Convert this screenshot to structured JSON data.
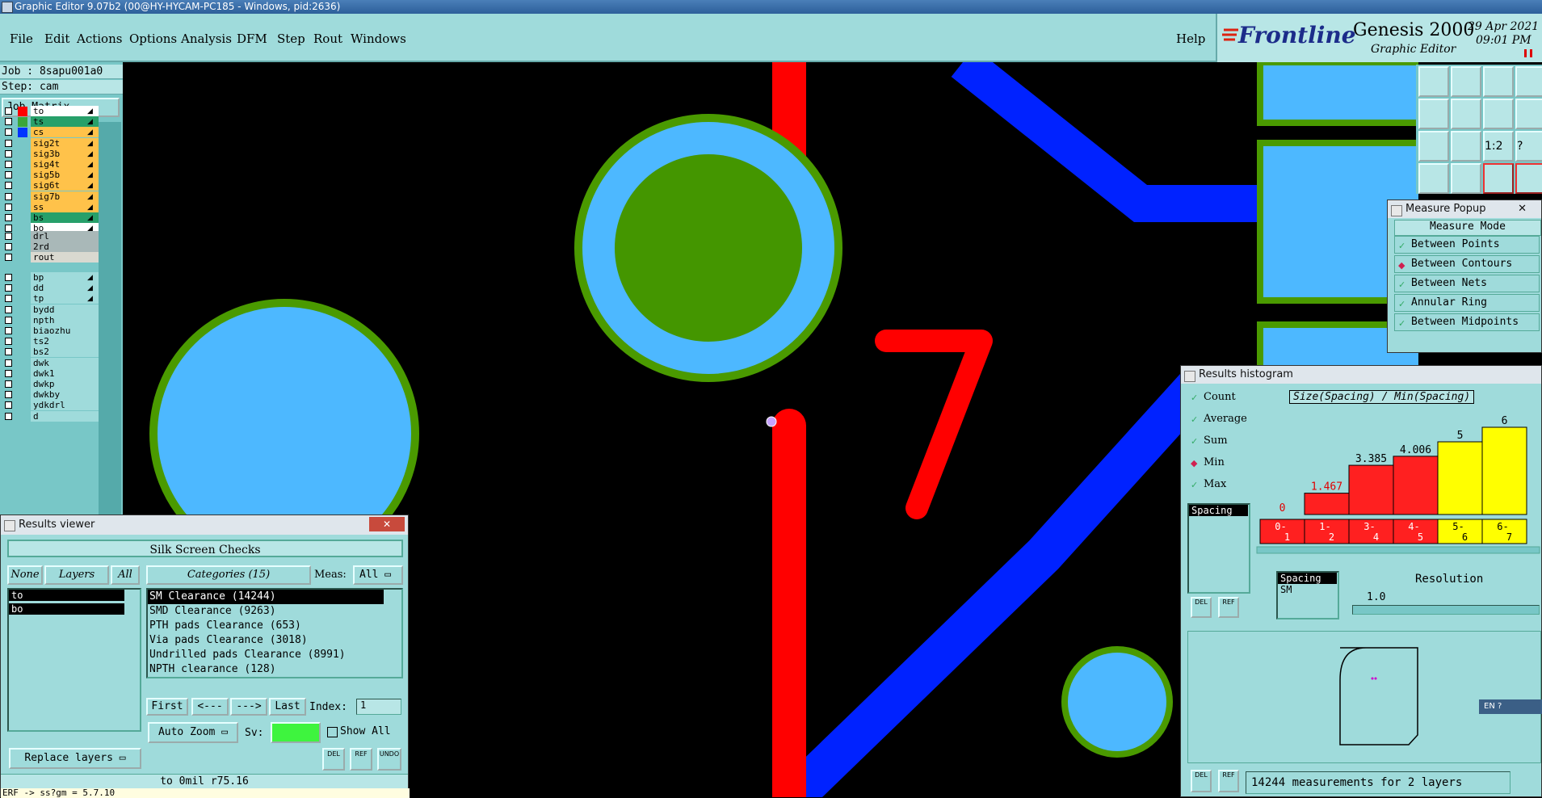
{
  "window": {
    "title": "Graphic Editor 9.07b2 (00@HY-HYCAM-PC185 - Windows, pid:2636)"
  },
  "menu": {
    "items": [
      "File",
      "Edit",
      "Actions",
      "Options",
      "Analysis",
      "DFM",
      "Step",
      "Rout",
      "Windows"
    ],
    "help": "Help"
  },
  "brand": {
    "logo": "Frontline",
    "product": "Genesis 2000",
    "subtitle": "Graphic Editor",
    "date": "29 Apr 2021",
    "time": "09:01 PM"
  },
  "job": {
    "job_label": "Job : 8sapu001a0",
    "step_label": "Step: cam",
    "job_matrix_button": "Job Matrix ..."
  },
  "layers": {
    "group1": [
      {
        "name": "to",
        "bg": "#ffffff",
        "color": "#ff0000",
        "arrow": "◢"
      },
      {
        "name": "ts",
        "bg": "#27a06a",
        "color": "#3aa63a",
        "arrow": "◢ ▫"
      },
      {
        "name": "cs",
        "bg": "#ffc24a",
        "color": "#0033ff",
        "arrow": "◢"
      },
      {
        "name": "sig2t",
        "bg": "#ffc24a",
        "color": "",
        "arrow": "◢"
      },
      {
        "name": "sig3b",
        "bg": "#ffc24a",
        "color": "",
        "arrow": "◢"
      },
      {
        "name": "sig4t",
        "bg": "#ffc24a",
        "color": "",
        "arrow": "◢"
      },
      {
        "name": "sig5b",
        "bg": "#ffc24a",
        "color": "",
        "arrow": "◢"
      },
      {
        "name": "sig6t",
        "bg": "#ffc24a",
        "color": "",
        "arrow": "◢"
      },
      {
        "name": "sig7b",
        "bg": "#ffc24a",
        "color": "",
        "arrow": "◢"
      },
      {
        "name": "ss",
        "bg": "#ffc24a",
        "color": "",
        "arrow": "◢"
      },
      {
        "name": "bs",
        "bg": "#27a06a",
        "color": "",
        "arrow": "◢"
      },
      {
        "name": "bo",
        "bg": "#ffffff",
        "color": "",
        "arrow": "◢"
      }
    ],
    "group2": [
      {
        "name": "drl",
        "bg": "#a9b8b8",
        "color": "",
        "arrow": ""
      },
      {
        "name": "2rd",
        "bg": "#a9b8b8",
        "color": "",
        "arrow": ""
      },
      {
        "name": "rout",
        "bg": "#d9d9d0",
        "color": "",
        "arrow": ""
      }
    ],
    "group3": [
      {
        "name": "bp",
        "bg": "#9fdbdb",
        "color": "",
        "arrow": "◢"
      },
      {
        "name": "dd",
        "bg": "#9fdbdb",
        "color": "",
        "arrow": "◢"
      },
      {
        "name": "tp",
        "bg": "#9fdbdb",
        "color": "",
        "arrow": "◢"
      },
      {
        "name": "bydd",
        "bg": "#9fdbdb",
        "color": "",
        "arrow": ""
      },
      {
        "name": "npth",
        "bg": "#9fdbdb",
        "color": "",
        "arrow": ""
      },
      {
        "name": "biaozhu",
        "bg": "#9fdbdb",
        "color": "",
        "arrow": ""
      },
      {
        "name": "ts2",
        "bg": "#9fdbdb",
        "color": "",
        "arrow": ""
      },
      {
        "name": "bs2",
        "bg": "#9fdbdb",
        "color": "",
        "arrow": ""
      },
      {
        "name": "dwk",
        "bg": "#9fdbdb",
        "color": "",
        "arrow": ""
      },
      {
        "name": "dwk1",
        "bg": "#9fdbdb",
        "color": "",
        "arrow": ""
      },
      {
        "name": "dwkp",
        "bg": "#9fdbdb",
        "color": "",
        "arrow": ""
      },
      {
        "name": "dwkby",
        "bg": "#9fdbdb",
        "color": "",
        "arrow": ""
      },
      {
        "name": "ydkdrl",
        "bg": "#9fdbdb",
        "color": "",
        "arrow": ""
      },
      {
        "name": "d",
        "bg": "#9fdbdb",
        "color": "",
        "arrow": ""
      }
    ]
  },
  "canvas": {
    "silk_text": "7"
  },
  "results_viewer": {
    "title": "Results viewer",
    "header": "Silk Screen Checks",
    "none_btn": "None",
    "layers_btn": "Layers",
    "all_btn": "All",
    "layers": [
      "to",
      "bo"
    ],
    "categories_label": "Categories (15)",
    "meas_label": "Meas:",
    "meas_value": "All",
    "categories": [
      "SM Clearance (14244)",
      "SMD Clearance (9263)",
      "PTH pads Clearance (653)",
      "Via pads Clearance (3018)",
      "Undrilled pads Clearance (8991)",
      "NPTH clearance (128)"
    ],
    "first": "First",
    "prev": "<---",
    "next": "--->",
    "last": "Last",
    "index_label": "Index:",
    "index_value": "1",
    "auto_zoom": "Auto Zoom",
    "sv_label": "Sv:",
    "show_all": "Show All",
    "replace_layers": "Replace layers",
    "del": "DEL",
    "ref": "REF",
    "undo": "UNDO",
    "status": "to 0mil  r75.16",
    "cmd": "ERF -> ss?gm = 5.7.10"
  },
  "measure_popup": {
    "title": "Measure Popup",
    "header": "Measure Mode",
    "modes": [
      "Between Points",
      "Between Contours",
      "Between Nets",
      "Annular Ring",
      "Between Midpoints"
    ],
    "selected": "Between Contours"
  },
  "histogram": {
    "title": "Results histogram",
    "options": [
      "Count",
      "Average",
      "Sum",
      "Min",
      "Max"
    ],
    "selected": "Min",
    "list_item": "Spacing",
    "chart_title": "Size(Spacing) / Min(Spacing)",
    "bins": [
      {
        "label1": "0-",
        "label2": "1",
        "value": 0,
        "text": "0",
        "color": "#ff2020"
      },
      {
        "label1": "1-",
        "label2": "2",
        "value": 1.467,
        "text": "1.467",
        "color": "#ff2020"
      },
      {
        "label1": "3-",
        "label2": "4",
        "value": 3.385,
        "text": "3.385",
        "color": "#ff2020"
      },
      {
        "label1": "4-",
        "label2": "5",
        "value": 4.006,
        "text": "4.006",
        "color": "#ff2020"
      },
      {
        "label1": "5-",
        "label2": "6",
        "value": 5,
        "text": "5",
        "color": "#ffff00"
      },
      {
        "label1": "6-",
        "label2": "7",
        "value": 6,
        "text": "6",
        "color": "#ffff00"
      }
    ],
    "spacing_list": [
      "Spacing",
      "SM"
    ],
    "resolution_label": "Resolution",
    "resolution_value": "1.0",
    "del": "DEL",
    "ref": "REF",
    "status": "14244 measurements for 2 layers"
  },
  "tray": {
    "ime": "EN"
  },
  "colors": {
    "pad_fill": "#4db8ff",
    "pad_ring": "#4a9a00",
    "trace_red": "#ff0000",
    "trace_blue": "#0022ff",
    "panel": "#9fdbdb"
  }
}
